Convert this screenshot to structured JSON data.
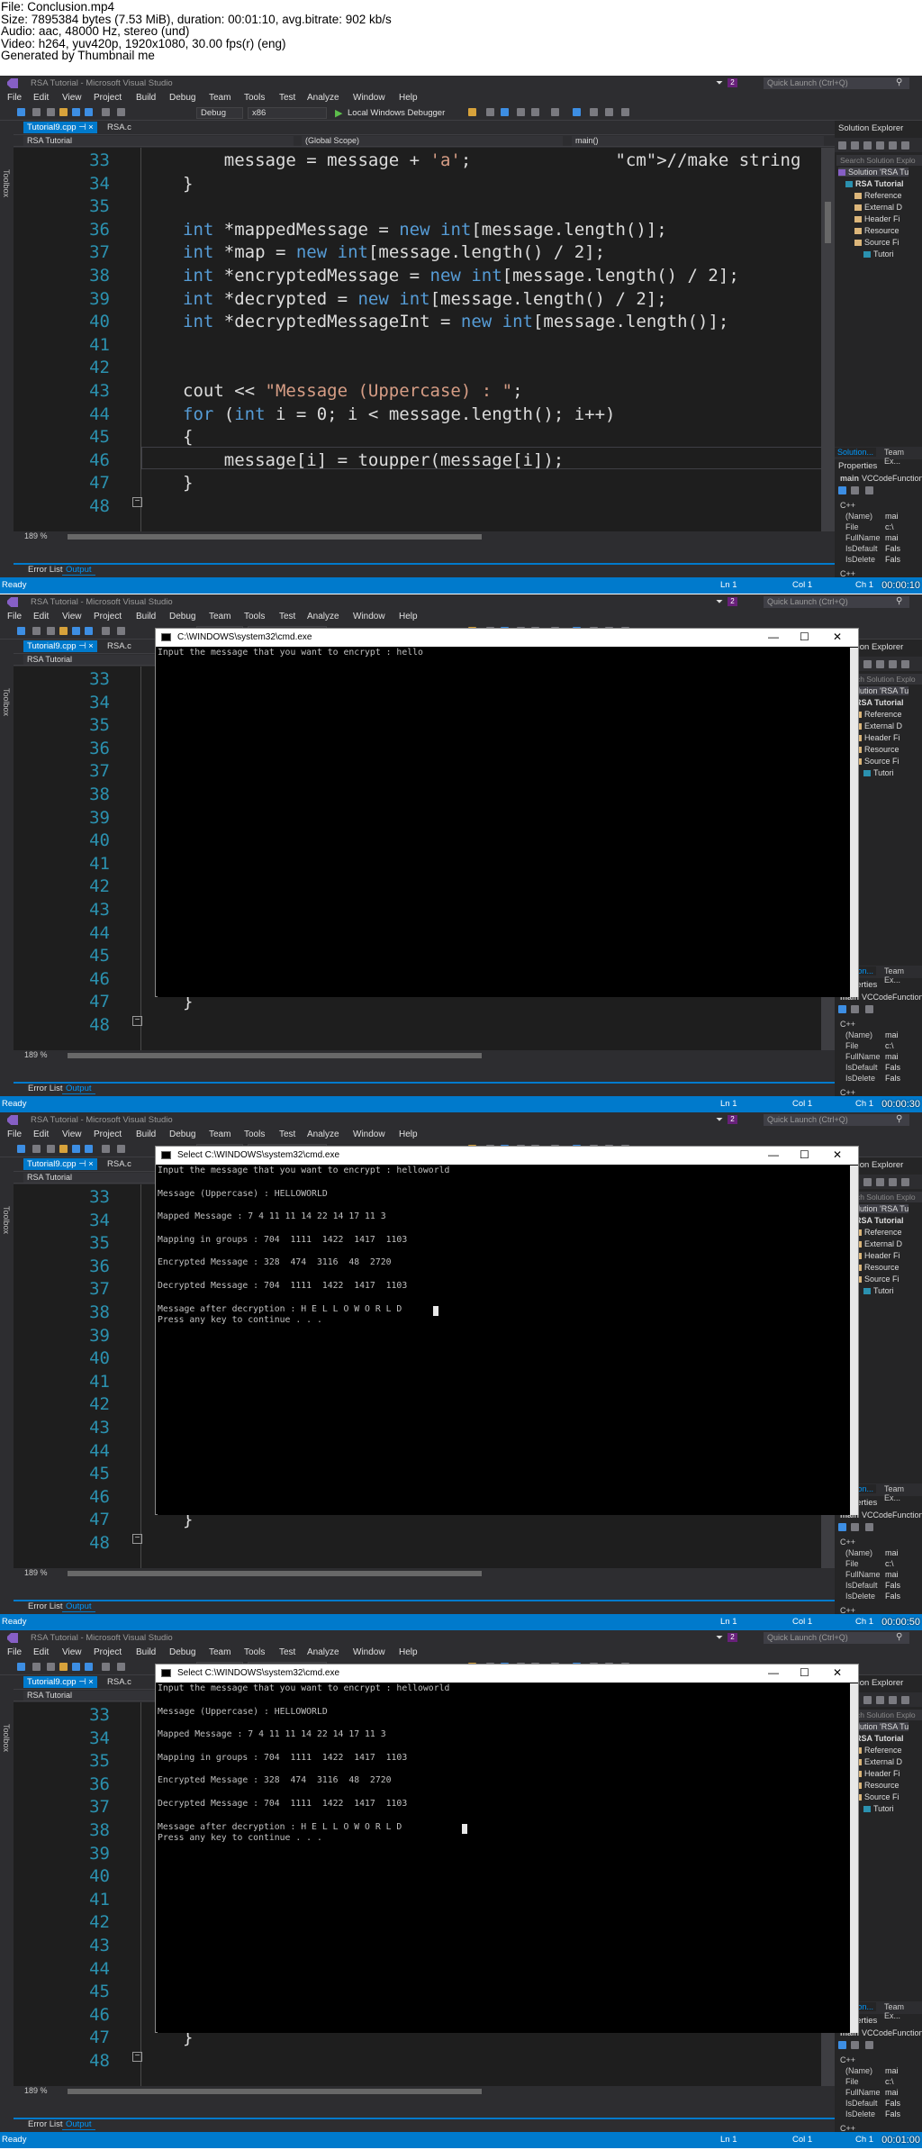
{
  "header": {
    "lines": [
      "File: Conclusion.mp4",
      "Size: 7895384 bytes (7.53 MiB), duration: 00:01:10, avg.bitrate: 902 kb/s",
      "Audio: aac, 48000 Hz, stereo (und)",
      "Video: h264, yuv420p, 1920x1080, 30.00 fps(r) (eng)",
      "Generated by Thumbnail me"
    ]
  },
  "vs": {
    "window_title": "RSA Tutorial - Microsoft Visual Studio",
    "notification_count": "2",
    "quick_launch": "Quick Launch (Ctrl+Q)",
    "menus": [
      "File",
      "Edit",
      "View",
      "Project",
      "Build",
      "Debug",
      "Team",
      "Tools",
      "Test",
      "Analyze",
      "Window",
      "Help"
    ],
    "config": "Debug",
    "platform": "x86",
    "debugger": "Local Windows Debugger",
    "toolbox": "Toolbox",
    "tabs": [
      "Tutorial9.cpp",
      "RSA.c"
    ],
    "tab_close": "⊣ ×",
    "nav_project": "RSA Tutorial",
    "nav_scope": "(Global Scope)",
    "nav_func": "main()",
    "zoom": "189 %",
    "output_tabs": [
      "Error List",
      "Output"
    ],
    "status_ready": "Ready",
    "status_ln": "Ln 1",
    "status_col": "Col 1",
    "status_ch": "Ch 1"
  },
  "code_lines": [
    {
      "num": "33",
      "text": "    message = message + 'a';              //make string"
    },
    {
      "num": "34",
      "text": "}"
    },
    {
      "num": "35",
      "text": ""
    },
    {
      "num": "36",
      "text": "int *mappedMessage = new int[message.length()];"
    },
    {
      "num": "37",
      "text": "int *map = new int[message.length() / 2];"
    },
    {
      "num": "38",
      "text": "int *encryptedMessage = new int[message.length() / 2];"
    },
    {
      "num": "39",
      "text": "int *decrypted = new int[message.length() / 2];"
    },
    {
      "num": "40",
      "text": "int *decryptedMessageInt = new int[message.length()];"
    },
    {
      "num": "41",
      "text": ""
    },
    {
      "num": "42",
      "text": ""
    },
    {
      "num": "43",
      "text": "cout << \"Message (Uppercase) : \";"
    },
    {
      "num": "44",
      "text": "for (int i = 0; i < message.length(); i++)"
    },
    {
      "num": "45",
      "text": "{"
    },
    {
      "num": "46",
      "text": "    message[i] = toupper(message[i]);"
    },
    {
      "num": "47",
      "text": "}"
    },
    {
      "num": "48",
      "text": ""
    }
  ],
  "brace_47": "}",
  "solution": {
    "title": "Solution Explorer",
    "search": "Search Solution Explo",
    "items": [
      "Solution 'RSA Tu",
      "RSA Tutorial",
      "Reference",
      "External D",
      "Header Fi",
      "Resource",
      "Source Fi",
      "Tutori"
    ],
    "tabs": [
      "Solution...",
      "Team Ex..."
    ],
    "properties_title": "Properties",
    "prop_object": "main",
    "prop_type": "VCCodeFunction",
    "prop_cat": "C++",
    "props": [
      {
        "k": "(Name)",
        "v": "mai"
      },
      {
        "k": "File",
        "v": "c:\\"
      },
      {
        "k": "FullName",
        "v": "mai"
      },
      {
        "k": "IsDefault",
        "v": "Fals"
      },
      {
        "k": "IsDelete",
        "v": "Fals"
      }
    ],
    "desc": "C++"
  },
  "console": {
    "title_plain": "C:\\WINDOWS\\system32\\cmd.exe",
    "title_select": "Select C:\\WINDOWS\\system32\\cmd.exe",
    "line_prompt_hello": "Input the message that you want to encrypt : hello",
    "lines_full": [
      "Input the message that you want to encrypt : helloworld",
      "",
      "Message (Uppercase) : HELLOWORLD",
      "",
      "Mapped Message : 7 4 11 11 14 22 14 17 11 3",
      "",
      "Mapping in groups : 704  1111  1422  1417  1103",
      "",
      "Encrypted Message : 328  474  3116  48  2720",
      "",
      "Decrypted Message : 704  1111  1422  1417  1103",
      "",
      "Message after decryption : H E L L O W O R L D",
      "Press any key to continue . . ."
    ]
  },
  "timestamps": [
    "00:00:10",
    "00:00:30",
    "00:00:50",
    "00:01:00"
  ]
}
